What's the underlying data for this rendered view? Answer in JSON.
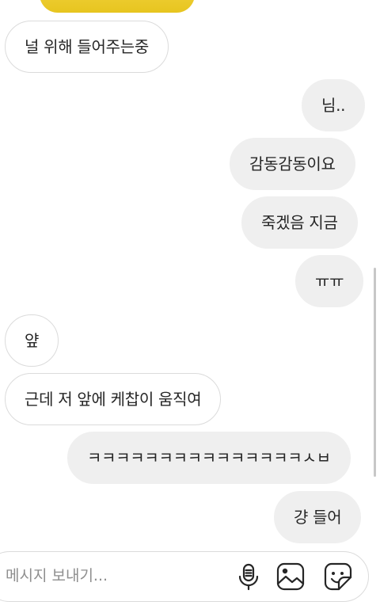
{
  "messages": [
    {
      "side": "in",
      "text": "널 위해 들어주는중"
    },
    {
      "side": "out",
      "text": "님.."
    },
    {
      "side": "out",
      "text": "감동감동이요"
    },
    {
      "side": "out",
      "text": "죽겠음 지금"
    },
    {
      "side": "out",
      "text": "ㅠㅠ"
    },
    {
      "side": "in",
      "text": "얖"
    },
    {
      "side": "in",
      "text": "근데 저 앞에 케찹이 움직여"
    },
    {
      "side": "out",
      "text": "ㅋㅋㅋㅋㅋㅋㅋㅋㅋㅋㅋㅋㅋㅋㅋㅅㅂ"
    },
    {
      "side": "out",
      "text": "걍 들어"
    }
  ],
  "composer": {
    "placeholder": "메시지 보내기...",
    "icons": [
      "microphone-icon",
      "gallery-icon",
      "sticker-icon"
    ]
  }
}
